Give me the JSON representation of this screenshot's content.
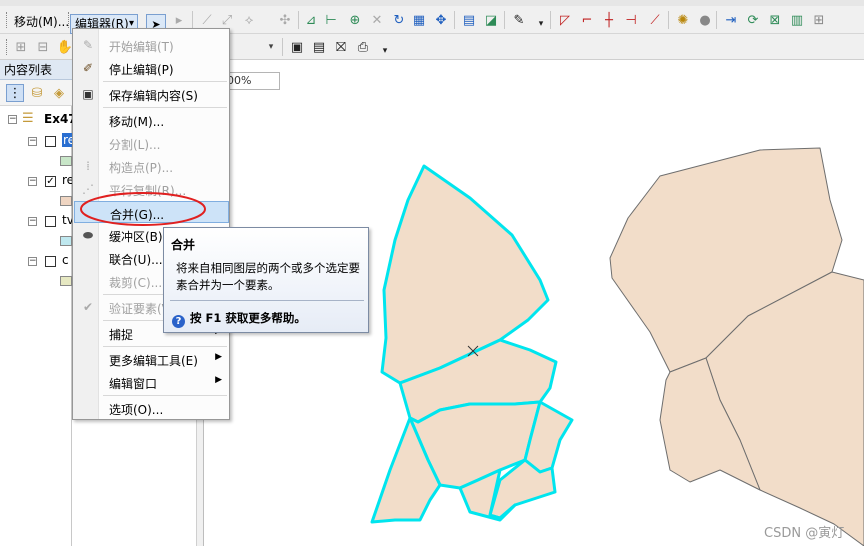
{
  "toolbar": {
    "move_label": "移动(M)...",
    "editor_label": "编辑器(R)",
    "editor_dropdown": "▾",
    "scale_value": "00%"
  },
  "toc": {
    "title": "内容列表",
    "root_label": "Ex47",
    "layers": [
      {
        "label": "re",
        "checked": false,
        "swatch": "#c8e6c8"
      },
      {
        "label": "re",
        "checked": true,
        "swatch": "#efd5c2"
      },
      {
        "label": "tv",
        "checked": false,
        "swatch": "#bfe8ef"
      },
      {
        "label": "c",
        "checked": false,
        "swatch": "#e6e8c2"
      }
    ]
  },
  "menu": {
    "items": [
      {
        "label": "开始编辑(T)",
        "enabled": false
      },
      {
        "label": "停止编辑(P)",
        "enabled": true
      },
      {
        "label": "保存编辑内容(S)",
        "enabled": true
      },
      {
        "label": "移动(M)...",
        "enabled": true
      },
      {
        "label": "分割(L)...",
        "enabled": false
      },
      {
        "label": "构造点(P)...",
        "enabled": false
      },
      {
        "label": "平行复制(R)...",
        "enabled": false
      },
      {
        "label": "合并(G)...",
        "enabled": true,
        "highlighted": true
      },
      {
        "label": "缓冲区(B)...",
        "enabled": true
      },
      {
        "label": "联合(U)...",
        "enabled": true
      },
      {
        "label": "裁剪(C)...",
        "enabled": false
      },
      {
        "label": "验证要素(V)",
        "enabled": false
      },
      {
        "label": "捕捉",
        "enabled": true,
        "submenu": true
      },
      {
        "label": "更多编辑工具(E)",
        "enabled": true,
        "submenu": true
      },
      {
        "label": "编辑窗口",
        "enabled": true,
        "submenu": true
      },
      {
        "label": "选项(O)...",
        "enabled": true
      }
    ]
  },
  "tooltip": {
    "title": "合并",
    "body": "将来自相同图层的两个或多个选定要素合并为一个要素。",
    "help": "按 F1 获取更多帮助。"
  },
  "colors": {
    "polygon_fill": "#f2ddc9",
    "selected_outline": "#00e5ee",
    "unselected_outline": "#6e6e6e",
    "annotation_red": "#e02020",
    "menu_highlight": "#cde3f8"
  },
  "watermark": "CSDN @寅灯"
}
